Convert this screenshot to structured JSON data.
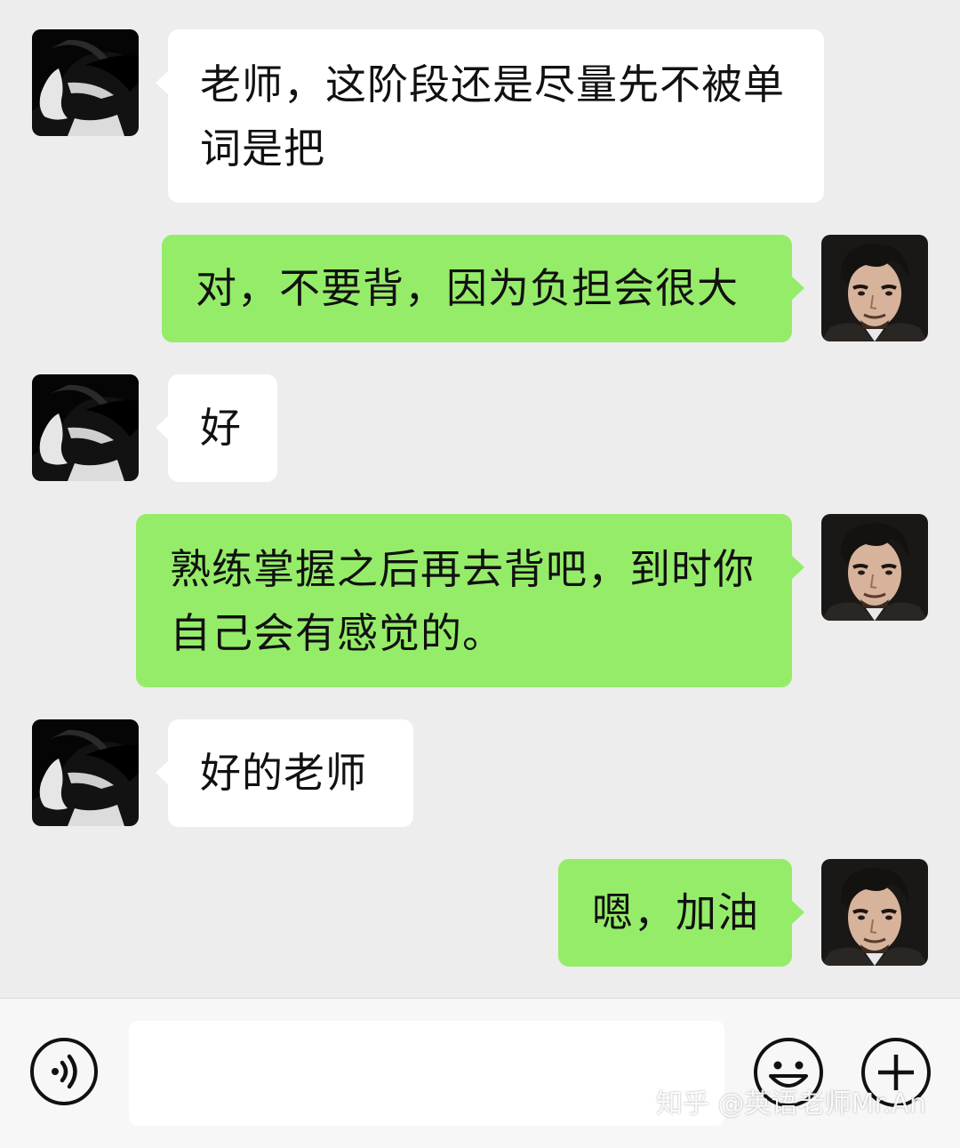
{
  "messages": [
    {
      "sender": "student",
      "text": "老师，这阶段还是尽量先不被单词是把"
    },
    {
      "sender": "teacher",
      "text": "对，不要背，因为负担会很大"
    },
    {
      "sender": "student",
      "text": "好"
    },
    {
      "sender": "teacher",
      "text": "熟练掌握之后再去背吧，到时你自己会有感觉的。"
    },
    {
      "sender": "student",
      "text": "好的老师"
    },
    {
      "sender": "teacher",
      "text": "嗯，加油"
    }
  ],
  "input_bar": {
    "voice_icon": "voice-icon",
    "message_value": "",
    "emoji_icon": "emoji-icon",
    "plus_icon": "plus-icon"
  },
  "watermark": "知乎 @英语老师Mr.An",
  "colors": {
    "background": "#ededed",
    "incoming_bubble": "#ffffff",
    "outgoing_bubble": "#95ec69",
    "input_bar": "#f7f7f7"
  }
}
